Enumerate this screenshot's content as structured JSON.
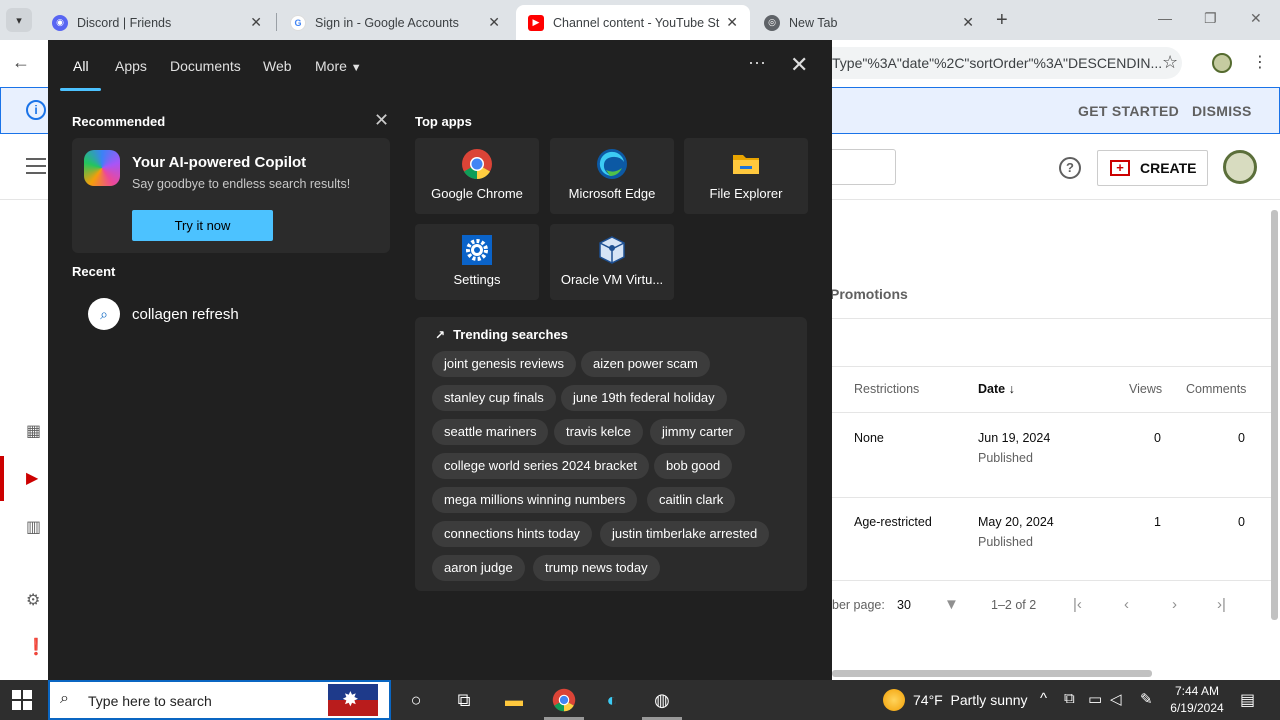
{
  "browser": {
    "tabs": [
      {
        "title": "Discord | Friends",
        "icon": "discord-icon",
        "color": "#5865F2"
      },
      {
        "title": "Sign in - Google Accounts",
        "icon": "google-icon",
        "color": "#4285F4"
      },
      {
        "title": "Channel content - YouTube Stu",
        "icon": "youtube-icon",
        "color": "#FF0000"
      },
      {
        "title": "New Tab",
        "icon": "chrome-icon",
        "color": "#5f6368"
      }
    ],
    "url_visible": "Type\"%3A\"date\"%2C\"sortOrder\"%3A\"DESCENDIN..."
  },
  "page": {
    "info_bar": {
      "get_started": "GET STARTED",
      "dismiss": "DISMISS"
    },
    "create_label": "CREATE",
    "tab_promotions": "Promotions",
    "table": {
      "headers": {
        "restrictions": "Restrictions",
        "date": "Date",
        "views": "Views",
        "comments": "Comments"
      },
      "rows": [
        {
          "restrictions": "None",
          "date": "Jun 19, 2024",
          "status": "Published",
          "views": "0",
          "comments": "0"
        },
        {
          "restrictions": "Age-restricted",
          "date": "May 20, 2024",
          "status": "Published",
          "views": "1",
          "comments": "0"
        }
      ]
    },
    "pager": {
      "per_page_label": "ber page:",
      "per_page_value": "30",
      "range": "1–2 of 2"
    }
  },
  "flyout": {
    "tabs": [
      "All",
      "Apps",
      "Documents",
      "Web",
      "More"
    ],
    "recommended_heading": "Recommended",
    "copilot": {
      "title": "Your AI-powered Copilot",
      "subtitle": "Say goodbye to endless search results!",
      "button": "Try it now"
    },
    "recent_heading": "Recent",
    "recent_items": [
      "collagen refresh"
    ],
    "top_apps_heading": "Top apps",
    "top_apps": [
      "Google Chrome",
      "Microsoft Edge",
      "File Explorer",
      "Settings",
      "Oracle VM Virtu..."
    ],
    "trending_heading": "Trending searches",
    "trending": [
      "joint genesis reviews",
      "aizen power scam",
      "stanley cup finals",
      "june 19th federal holiday",
      "seattle mariners",
      "travis kelce",
      "jimmy carter",
      "college world series 2024 bracket",
      "bob good",
      "mega millions winning numbers",
      "caitlin clark",
      "connections hints today",
      "justin timberlake arrested",
      "aaron judge",
      "trump news today"
    ]
  },
  "taskbar": {
    "search_placeholder": "Type here to search",
    "weather": {
      "temp": "74°F",
      "condition": "Partly sunny"
    },
    "time": "7:44 AM",
    "date": "6/19/2024"
  },
  "colors": {
    "accent": "#4cc2ff",
    "flyout_bg": "#202020",
    "yt_red": "#cc0000"
  }
}
